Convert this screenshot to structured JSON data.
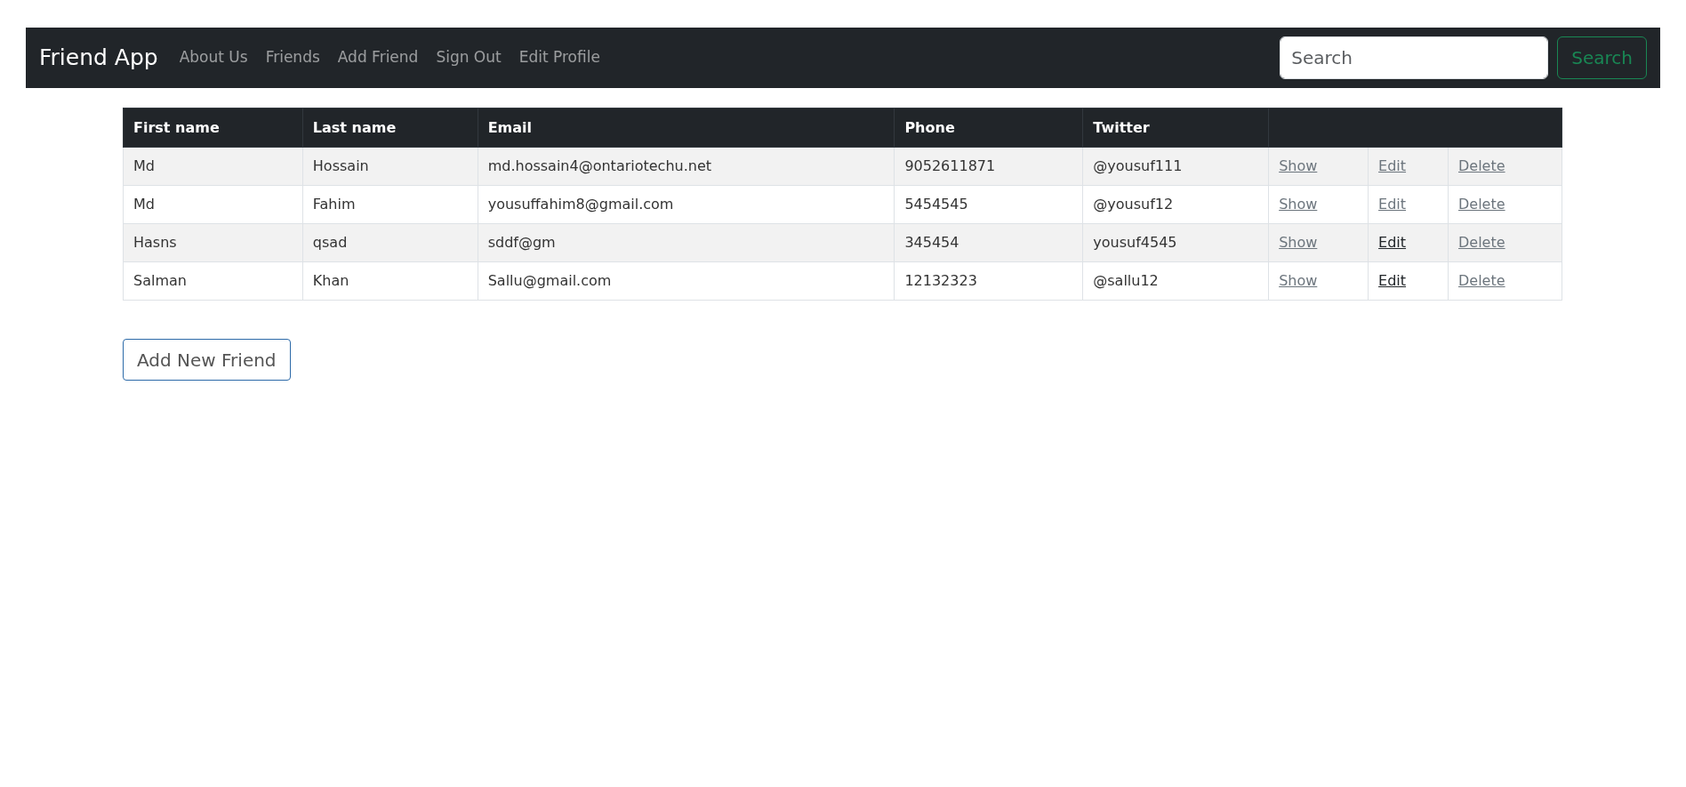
{
  "navbar": {
    "brand": "Friend App",
    "links": [
      "About Us",
      "Friends",
      "Add Friend",
      "Sign Out",
      "Edit Profile"
    ],
    "search": {
      "placeholder": "Search",
      "button": "Search"
    }
  },
  "table": {
    "columns": [
      "First name",
      "Last name",
      "Email",
      "Phone",
      "Twitter"
    ],
    "rows": [
      {
        "cells": [
          "Md",
          "Hossain",
          "md.hossain4@ontariotechu.net",
          "9052611871",
          "@yousuf111"
        ],
        "actions": [
          {
            "label": "Show",
            "visited": false
          },
          {
            "label": "Edit",
            "visited": false
          },
          {
            "label": "Delete",
            "visited": false
          }
        ]
      },
      {
        "cells": [
          "Md",
          "Fahim",
          "yousuffahim8@gmail.com",
          "5454545",
          "@yousuf12"
        ],
        "actions": [
          {
            "label": "Show",
            "visited": false
          },
          {
            "label": "Edit",
            "visited": false
          },
          {
            "label": "Delete",
            "visited": false
          }
        ]
      },
      {
        "cells": [
          "Hasns",
          "qsad",
          "sddf@gm",
          "345454",
          "yousuf4545"
        ],
        "actions": [
          {
            "label": "Show",
            "visited": false
          },
          {
            "label": "Edit",
            "visited": true
          },
          {
            "label": "Delete",
            "visited": false
          }
        ]
      },
      {
        "cells": [
          "Salman",
          "Khan",
          "Sallu@gmail.com",
          "12132323",
          "@sallu12"
        ],
        "actions": [
          {
            "label": "Show",
            "visited": false
          },
          {
            "label": "Edit",
            "visited": true
          },
          {
            "label": "Delete",
            "visited": false
          }
        ]
      }
    ]
  },
  "add_button": "Add New Friend"
}
